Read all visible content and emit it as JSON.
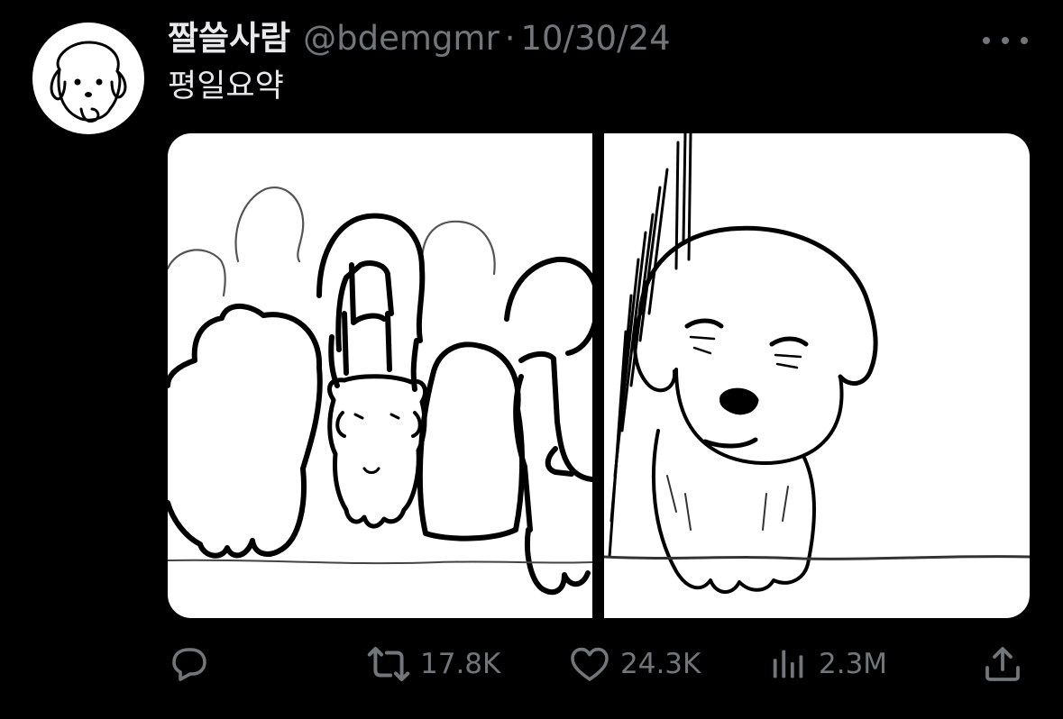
{
  "tweet": {
    "author": {
      "display_name": "짤쓸사람",
      "handle": "@bdemgmr",
      "avatar_icon": "puppy-avatar-icon"
    },
    "separator": "·",
    "date": "10/30/24",
    "text": "평일요약",
    "media": [
      {
        "kind": "illustration",
        "icon": "crowded-subway-puppy-drawing"
      },
      {
        "kind": "illustration",
        "icon": "tired-puppy-drawing"
      }
    ],
    "actions": {
      "reply": {
        "icon": "reply-icon",
        "count": ""
      },
      "retweet": {
        "icon": "retweet-icon",
        "count": "17.8K"
      },
      "like": {
        "icon": "heart-icon",
        "count": "24.3K"
      },
      "views": {
        "icon": "views-icon",
        "count": "2.3M"
      },
      "share": {
        "icon": "share-icon"
      }
    },
    "more_icon": "more-icon"
  },
  "colors": {
    "background": "#000000",
    "primary_text": "#e7e9ea",
    "secondary_text": "#71767b"
  }
}
